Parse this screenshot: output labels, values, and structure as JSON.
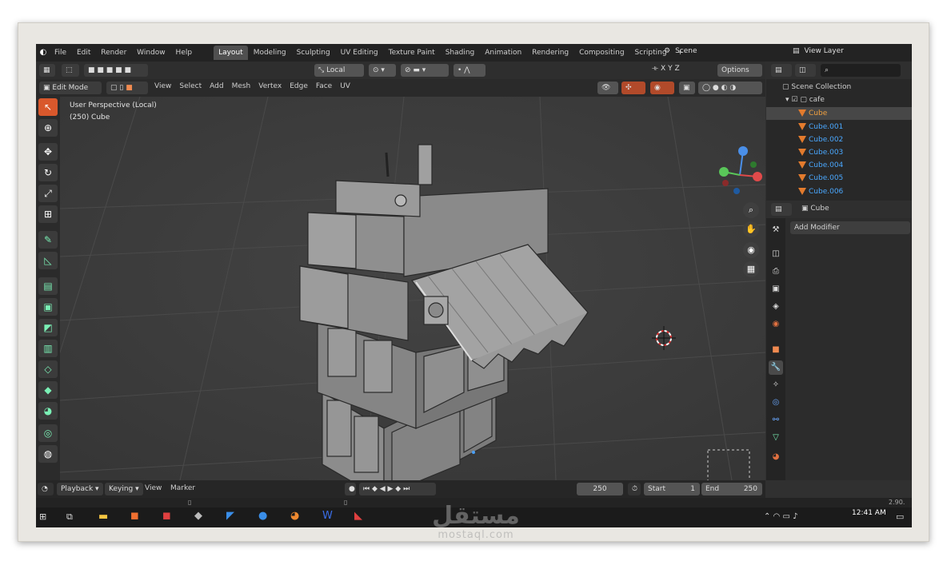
{
  "topbar": {
    "menus": [
      "File",
      "Edit",
      "Render",
      "Window",
      "Help"
    ],
    "tabs": [
      "Layout",
      "Modeling",
      "Sculpting",
      "UV Editing",
      "Texture Paint",
      "Shading",
      "Animation",
      "Rendering",
      "Compositing",
      "Scripting"
    ],
    "add_tab": "+",
    "scene": "Scene",
    "view_layer": "View Layer"
  },
  "header": {
    "transform_orientation": "Local",
    "options": "Options",
    "xyz": [
      "X",
      "Y",
      "Z"
    ]
  },
  "header2": {
    "mode": "Edit Mode",
    "menus": [
      "View",
      "Select",
      "Add",
      "Mesh",
      "Vertex",
      "Edge",
      "Face",
      "UV"
    ]
  },
  "viewport": {
    "perspective": "User Perspective (Local)",
    "object": "(250) Cube"
  },
  "timeline": {
    "playback": "Playback",
    "keying": "Keying",
    "view": "View",
    "marker": "Marker",
    "current_frame": "250",
    "start_label": "Start",
    "start": "1",
    "end_label": "End",
    "end": "250"
  },
  "outliner": {
    "collection": "Scene Collection",
    "group": "cafe",
    "items": [
      {
        "name": "Cube",
        "active": true
      },
      {
        "name": "Cube.001"
      },
      {
        "name": "Cube.002"
      },
      {
        "name": "Cube.003"
      },
      {
        "name": "Cube.004"
      },
      {
        "name": "Cube.005"
      },
      {
        "name": "Cube.006"
      }
    ]
  },
  "properties": {
    "object": "Cube",
    "add_modifier": "Add Modifier"
  },
  "version": "2.90.",
  "clock": "12:41 AM",
  "watermark": {
    "arabic": "مستقل",
    "latin": "mostaql.com"
  },
  "colors": {
    "accent": "#d9582c",
    "outliner_name": "#4aa8ff",
    "active_name": "#f0a040"
  }
}
